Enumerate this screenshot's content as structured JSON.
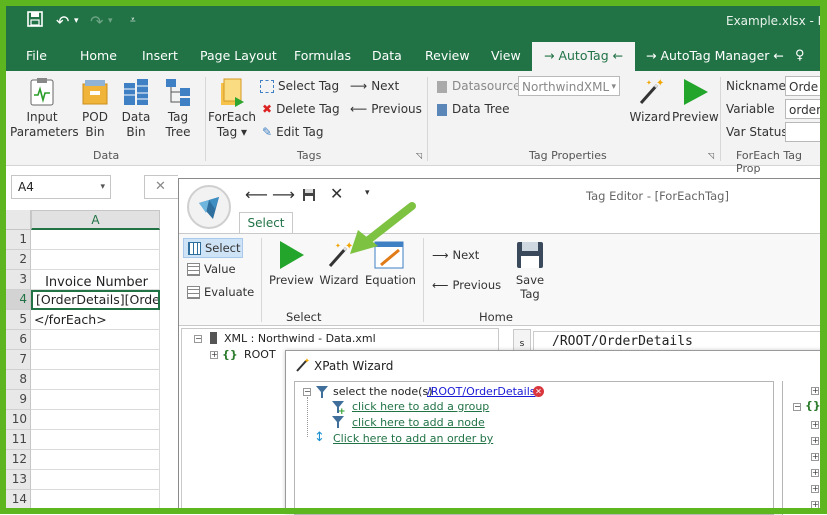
{
  "window": {
    "title": "Example.xlsx - Exc"
  },
  "tabs": [
    {
      "label": "File"
    },
    {
      "label": "Home"
    },
    {
      "label": "Insert"
    },
    {
      "label": "Page Layout"
    },
    {
      "label": "Formulas"
    },
    {
      "label": "Data"
    },
    {
      "label": "Review"
    },
    {
      "label": "View"
    },
    {
      "label": "→ AutoTag ←"
    },
    {
      "label": "→ AutoTag Manager ←"
    }
  ],
  "ribbon": {
    "data_group": {
      "label": "Data",
      "input_parameters": [
        "Input",
        "Parameters"
      ],
      "pod_bin": [
        "POD",
        "Bin"
      ],
      "data_bin": [
        "Data",
        "Bin"
      ],
      "tag_tree": [
        "Tag",
        "Tree"
      ]
    },
    "tags_group": {
      "label": "Tags",
      "foreach_tag": [
        "ForEach",
        "Tag ▾"
      ],
      "select_tag": "Select Tag",
      "delete_tag": "Delete Tag",
      "edit_tag": "Edit Tag",
      "next": "Next",
      "previous": "Previous"
    },
    "tag_properties": {
      "label": "Tag Properties",
      "datasource_label": "Datasource",
      "datasource_value": "NorthwindXML",
      "data_tree": "Data Tree",
      "wizard": "Wizard",
      "preview": "Preview"
    },
    "foreach_props": {
      "label": "ForEach Tag Prop",
      "nickname_label": "Nickname",
      "nickname_value": "Orde",
      "variable_label": "Variable",
      "variable_value": "orderD",
      "varstatus_label": "Var Status",
      "varstatus_value": ""
    }
  },
  "sheet": {
    "name_box": "A4",
    "column": "A",
    "rows": [
      "1",
      "2",
      "3",
      "4",
      "5",
      "6",
      "7",
      "8",
      "9",
      "10",
      "11",
      "12",
      "13",
      "14"
    ],
    "cells": {
      "r3": "Invoice Number",
      "r4": "[OrderDetails][Orde[Pr",
      "r5": "</forEach>"
    }
  },
  "tag_editor": {
    "title": "Tag Editor - [ForEachTag]",
    "tab": "Select",
    "select": "Select",
    "value": "Value",
    "evaluate": "Evaluate",
    "preview": "Preview",
    "wizard": "Wizard",
    "equation": "Equation",
    "next": "Next",
    "previous": "Previous",
    "save_tag": "Save Tag",
    "group_select": "Select",
    "group_home": "Home",
    "tree_root_label": "XML : Northwind - Data.xml",
    "tree_child": "ROOT",
    "xpath": "/ROOT/OrderDetails",
    "s_label": "s"
  },
  "xpath_wizard": {
    "title": "XPath Wizard",
    "select_text": "select the node(s)",
    "select_path": "/ROOT/OrderDetails",
    "add_group": "click here to add a group",
    "add_node": "click here to add a node",
    "add_order": "Click here to add an order by"
  },
  "colors": {
    "excel_green": "#217346",
    "frame_green": "#5db61f",
    "arrow_green": "#7dc241"
  }
}
